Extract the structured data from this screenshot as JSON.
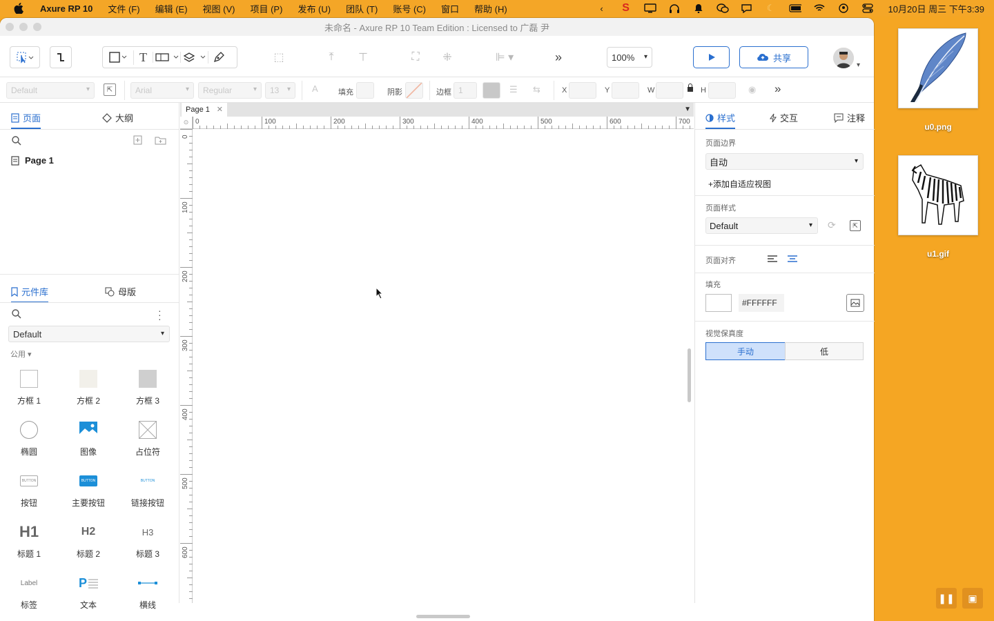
{
  "menubar": {
    "app_name": "Axure RP 10",
    "menus": [
      "文件 (F)",
      "编辑 (E)",
      "视图 (V)",
      "项目 (P)",
      "发布 (U)",
      "团队 (T)",
      "账号 (C)",
      "窗口",
      "帮助 (H)"
    ],
    "clock": "10月20日 周三 下午3:39"
  },
  "window": {
    "title": "未命名 - Axure RP 10 Team Edition : Licensed to 广磊 尹"
  },
  "toolbar": {
    "zoom": "100%",
    "share_label": "共享"
  },
  "propbar": {
    "style_value": "Default",
    "font_value": "Arial",
    "weight_value": "Regular",
    "size_value": "13",
    "fill_label": "填充",
    "shadow_label": "阴影",
    "border_label": "边框",
    "border_value": "1",
    "x_label": "X",
    "y_label": "Y",
    "w_label": "W",
    "h_label": "H"
  },
  "left_panel": {
    "tabs": [
      "页面",
      "大纲"
    ],
    "pages": [
      "Page 1"
    ],
    "lib_tabs": [
      "元件库",
      "母版"
    ],
    "library": "Default",
    "group": "公用",
    "widgets": [
      {
        "label": "方框 1",
        "icon": "box1-icon"
      },
      {
        "label": "方框 2",
        "icon": "box2-icon"
      },
      {
        "label": "方框 3",
        "icon": "box3-icon"
      },
      {
        "label": "椭圆",
        "icon": "ellipse-icon"
      },
      {
        "label": "图像",
        "icon": "image-icon"
      },
      {
        "label": "占位符",
        "icon": "placeholder-icon"
      },
      {
        "label": "按钮",
        "icon": "button-icon"
      },
      {
        "label": "主要按钮",
        "icon": "primary-button-icon"
      },
      {
        "label": "链接按钮",
        "icon": "link-button-icon"
      },
      {
        "label": "标题 1",
        "icon": "h1-icon"
      },
      {
        "label": "标题 2",
        "icon": "h2-icon"
      },
      {
        "label": "标题 3",
        "icon": "h3-icon"
      },
      {
        "label": "标签",
        "icon": "label-icon"
      },
      {
        "label": "文本",
        "icon": "text-icon"
      },
      {
        "label": "横线",
        "icon": "hline-icon"
      }
    ],
    "widget_glyphs": {
      "button": "BUTTON",
      "h1": "H1",
      "h2": "H2",
      "h3": "H3",
      "label": "Label",
      "text": "P"
    }
  },
  "canvas": {
    "tab": "Page 1",
    "hruler": [
      "0",
      "100",
      "200",
      "300",
      "400",
      "500",
      "600",
      "700"
    ],
    "vruler": [
      "0",
      "100",
      "200",
      "300",
      "400",
      "500",
      "600"
    ]
  },
  "right_panel": {
    "tabs": [
      "样式",
      "交互",
      "注释"
    ],
    "page_bounds_title": "页面边界",
    "page_bounds_value": "自动",
    "add_adaptive": "添加自适应视图",
    "page_style_title": "页面样式",
    "page_style_value": "Default",
    "page_align_title": "页面对齐",
    "fill_title": "填充",
    "fill_value": "#FFFFFF",
    "fidelity_title": "视觉保真度",
    "fidelity_options": [
      "手动",
      "低"
    ]
  },
  "desktop": {
    "icons": [
      {
        "label": "u0.png",
        "icon": "feather-icon"
      },
      {
        "label": "u1.gif",
        "icon": "zebra-icon"
      }
    ]
  },
  "colors": {
    "accent": "#2a6fcf",
    "desktop": "#f5a623"
  }
}
